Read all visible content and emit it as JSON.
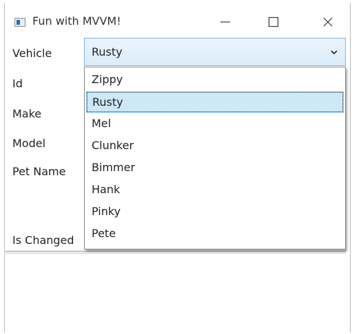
{
  "window": {
    "title": "Fun with MVVM!"
  },
  "form": {
    "labels": {
      "vehicle": "Vehicle",
      "id": "Id",
      "make": "Make",
      "model": "Model",
      "pet_name": "Pet Name",
      "is_changed": "Is Changed"
    },
    "vehicle_combo": {
      "selected": "Rusty",
      "options": [
        "Zippy",
        "Rusty",
        "Mel",
        "Clunker",
        "Bimmer",
        "Hank",
        "Pinky",
        "Pete"
      ],
      "highlighted_index": 1
    }
  },
  "icons": {
    "app": "app-window-icon",
    "minimize": "minimize-icon",
    "maximize": "maximize-icon",
    "close": "close-icon",
    "dropdown": "chevron-down-icon"
  },
  "colors": {
    "combo_border": "#7eb4ea",
    "selection_bg": "#cde8f7"
  }
}
